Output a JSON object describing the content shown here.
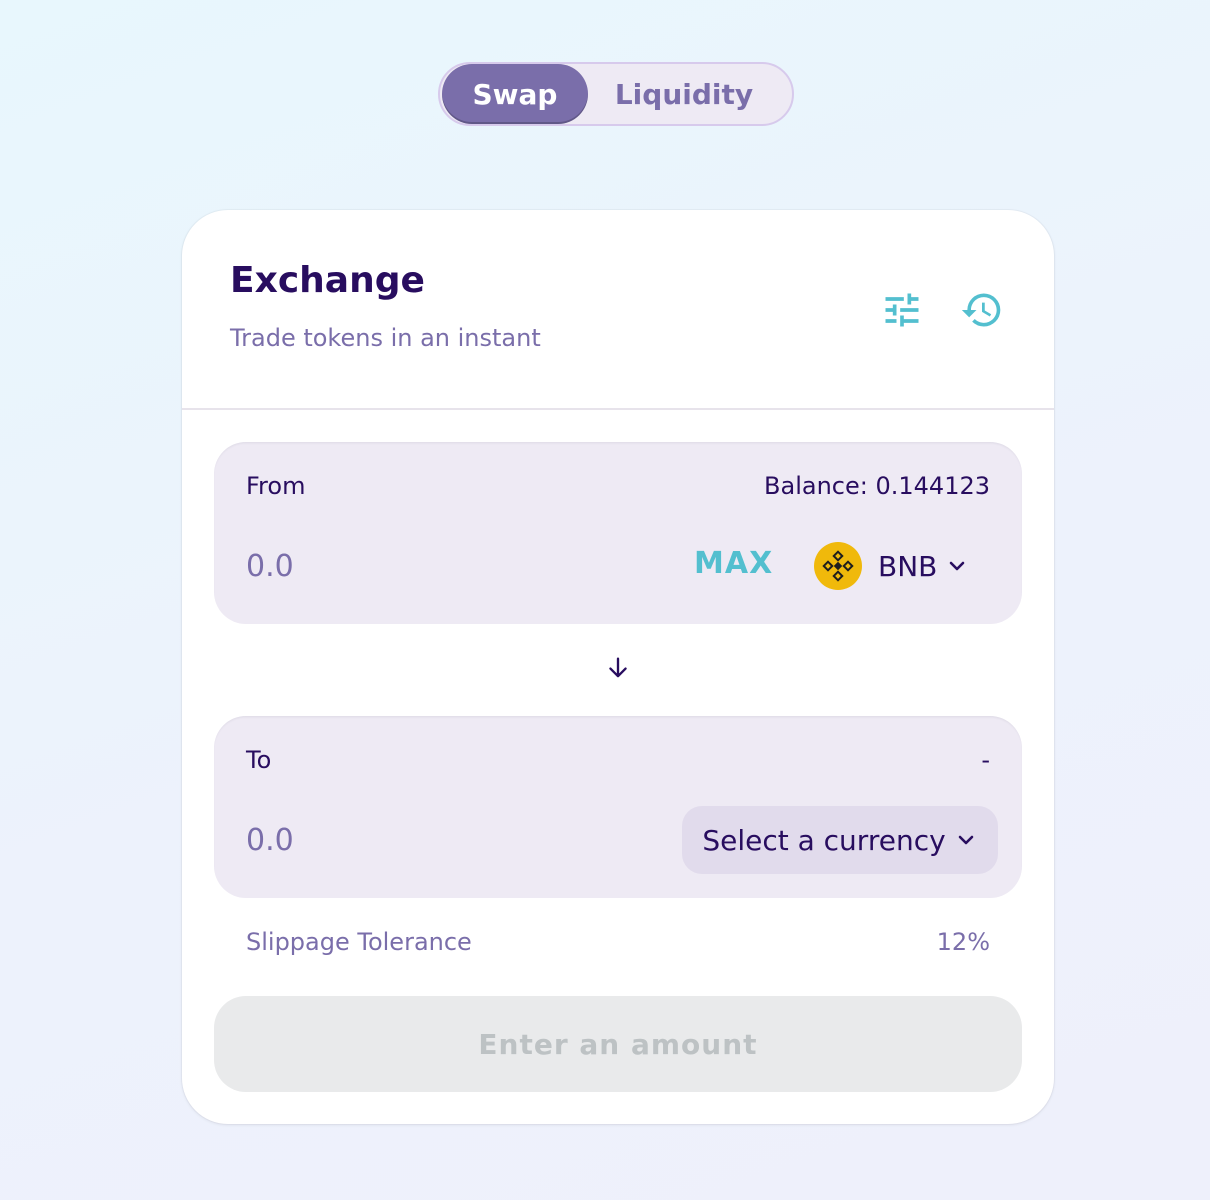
{
  "tabs": {
    "swap_label": "Swap",
    "liquidity_label": "Liquidity",
    "active": "Swap"
  },
  "card": {
    "title": "Exchange",
    "subtitle": "Trade tokens in an instant",
    "icons": [
      "settings-sliders-icon",
      "history-icon"
    ]
  },
  "from": {
    "label": "From",
    "balance": "Balance: 0.144123",
    "amount_placeholder": "0.0",
    "max_label": "MAX",
    "token_symbol": "BNB",
    "token_icon": "bnb-logo-icon"
  },
  "to": {
    "label": "To",
    "balance": "-",
    "amount_placeholder": "0.0",
    "select_label": "Select a currency"
  },
  "slippage": {
    "label": "Slippage Tolerance",
    "value": "12%"
  },
  "submit": {
    "label": "Enter an amount",
    "disabled": true
  },
  "colors": {
    "primary_text": "#280d5f",
    "secondary_text": "#7a6eaa",
    "accent": "#53bfcf",
    "active_tab_bg": "#7a6eaa",
    "input_bg": "#eeeaf4",
    "bnb_yellow": "#f0b90b"
  }
}
